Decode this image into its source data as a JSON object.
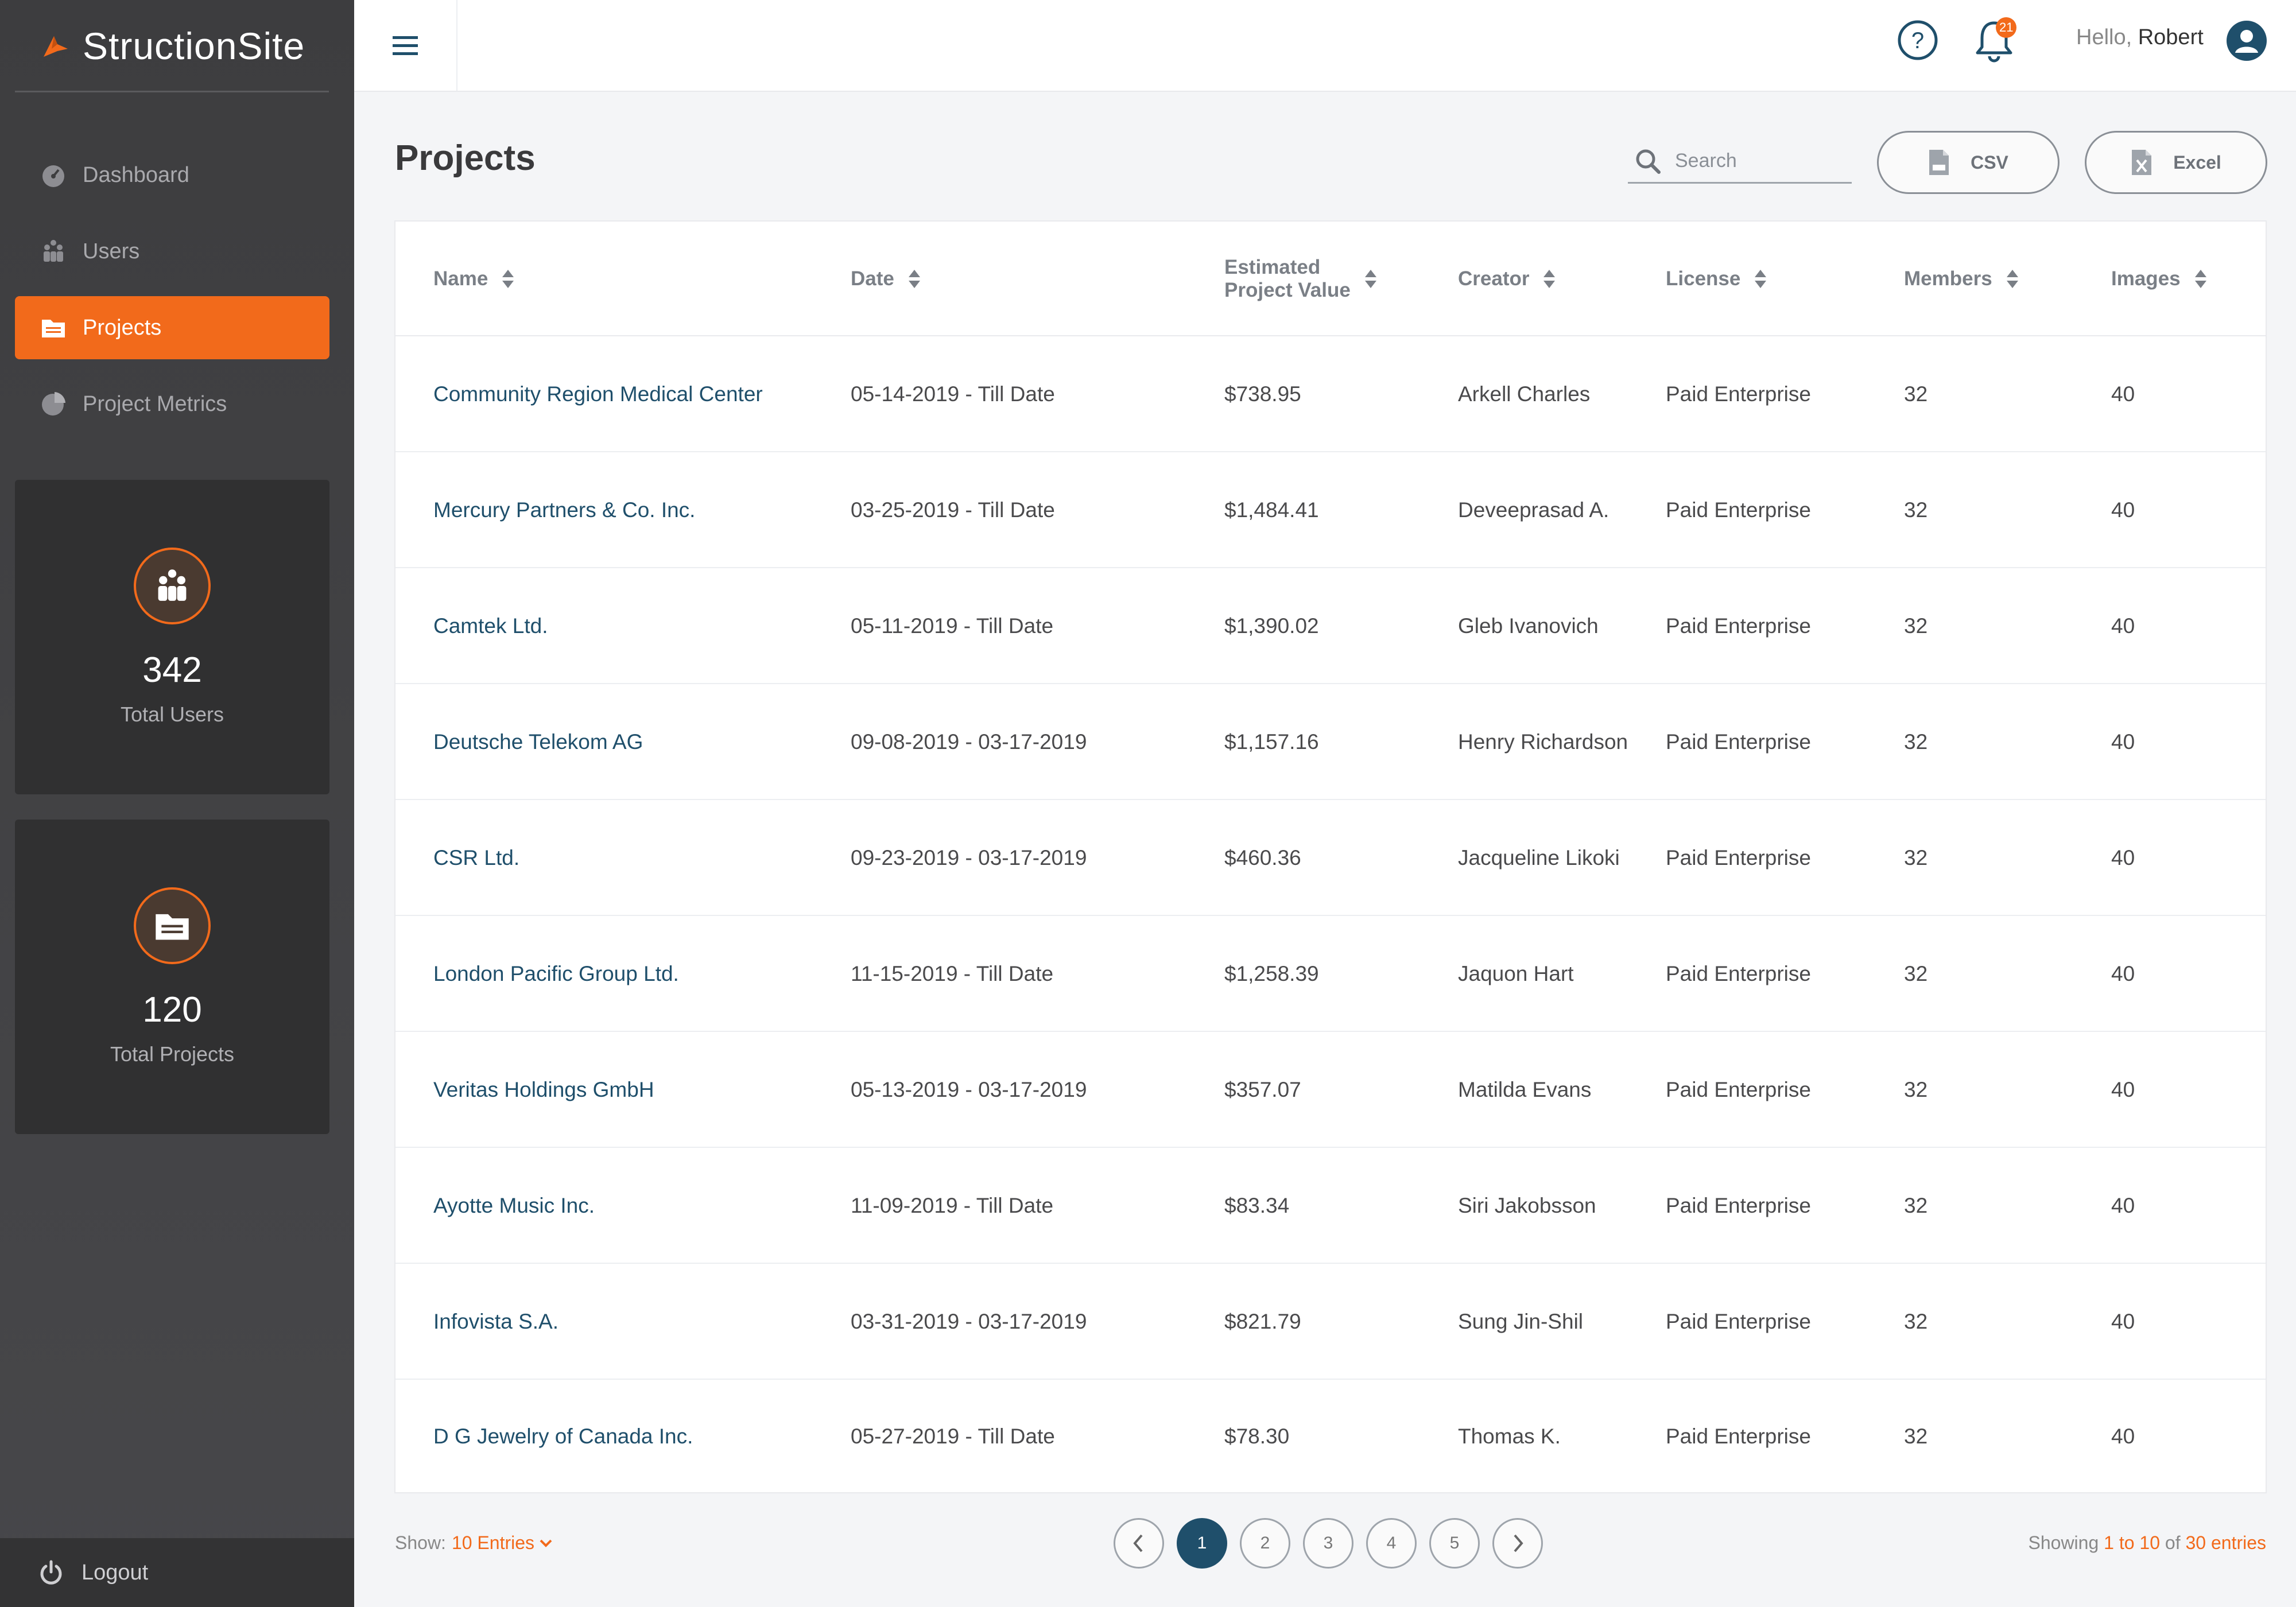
{
  "app": {
    "name": "StructionSite"
  },
  "sidebar": {
    "items": [
      {
        "label": "Dashboard",
        "icon": "gauge-icon"
      },
      {
        "label": "Users",
        "icon": "users-icon"
      },
      {
        "label": "Projects",
        "icon": "folder-icon",
        "active": true
      },
      {
        "label": "Project Metrics",
        "icon": "pie-chart-icon"
      }
    ],
    "stats": [
      {
        "value": "342",
        "label": "Total Users",
        "icon": "users-icon"
      },
      {
        "value": "120",
        "label": "Total Projects",
        "icon": "folder-icon"
      }
    ],
    "logout_label": "Logout"
  },
  "header": {
    "notification_count": "21",
    "greeting_prefix": "Hello,",
    "user_name": "Robert"
  },
  "page": {
    "title": "Projects",
    "search_placeholder": "Search",
    "csv_label": "CSV",
    "excel_label": "Excel"
  },
  "table": {
    "headers": {
      "name": "Name",
      "date": "Date",
      "value_line1": "Estimated",
      "value_line2": "Project Value",
      "creator": "Creator",
      "license": "License",
      "members": "Members",
      "images": "Images"
    },
    "rows": [
      {
        "name": "Community Region Medical Center",
        "date": "05-14-2019 - Till Date",
        "value": "$738.95",
        "creator": "Arkell Charles",
        "license": "Paid Enterprise",
        "members": "32",
        "images": "40"
      },
      {
        "name": "Mercury Partners & Co. Inc.",
        "date": "03-25-2019 - Till Date",
        "value": "$1,484.41",
        "creator": "Deveeprasad A.",
        "license": "Paid Enterprise",
        "members": "32",
        "images": "40"
      },
      {
        "name": "Camtek Ltd.",
        "date": "05-11-2019 - Till Date",
        "value": "$1,390.02",
        "creator": "Gleb Ivanovich",
        "license": "Paid Enterprise",
        "members": "32",
        "images": "40"
      },
      {
        "name": "Deutsche Telekom AG",
        "date": "09-08-2019 - 03-17-2019",
        "value": "$1,157.16",
        "creator": "Henry Richardson",
        "license": "Paid Enterprise",
        "members": "32",
        "images": "40"
      },
      {
        "name": "CSR Ltd.",
        "date": "09-23-2019 - 03-17-2019",
        "value": "$460.36",
        "creator": "Jacqueline Likoki",
        "license": "Paid Enterprise",
        "members": "32",
        "images": "40"
      },
      {
        "name": "London Pacific Group Ltd.",
        "date": "11-15-2019 - Till Date",
        "value": "$1,258.39",
        "creator": "Jaquon Hart",
        "license": "Paid Enterprise",
        "members": "32",
        "images": "40"
      },
      {
        "name": "Veritas Holdings GmbH",
        "date": "05-13-2019 - 03-17-2019",
        "value": "$357.07",
        "creator": "Matilda Evans",
        "license": "Paid Enterprise",
        "members": "32",
        "images": "40"
      },
      {
        "name": "Ayotte Music Inc.",
        "date": "11-09-2019 - Till Date",
        "value": "$83.34",
        "creator": "Siri Jakobsson",
        "license": "Paid Enterprise",
        "members": "32",
        "images": "40"
      },
      {
        "name": "Infovista S.A.",
        "date": "03-31-2019 - 03-17-2019",
        "value": "$821.79",
        "creator": "Sung Jin-Shil",
        "license": "Paid Enterprise",
        "members": "32",
        "images": "40"
      },
      {
        "name": "D G Jewelry of Canada Inc.",
        "date": "05-27-2019 - Till Date",
        "value": "$78.30",
        "creator": "Thomas K.",
        "license": "Paid Enterprise",
        "members": "32",
        "images": "40"
      }
    ]
  },
  "footer": {
    "show_label": "Show:",
    "show_value": "10 Entries",
    "pages": [
      "1",
      "2",
      "3",
      "4",
      "5"
    ],
    "active_page": "1",
    "showing_prefix": "Showing",
    "showing_range": "1 to 10",
    "showing_of": "of",
    "showing_total": "30 entries"
  },
  "colors": {
    "accent": "#f26a1b",
    "primary": "#1f4f6b",
    "sidebar": "#3d3d3f"
  }
}
